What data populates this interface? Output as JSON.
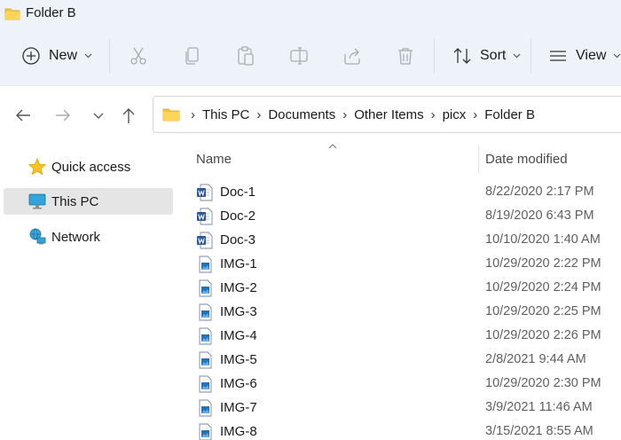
{
  "window": {
    "title": "Folder B"
  },
  "toolbar": {
    "new_label": "New",
    "sort_label": "Sort",
    "view_label": "View"
  },
  "breadcrumb": {
    "items": [
      "This PC",
      "Documents",
      "Other Items",
      "picx",
      "Folder B"
    ]
  },
  "sidebar": {
    "items": [
      {
        "label": "Quick access",
        "icon": "star-icon"
      },
      {
        "label": "This PC",
        "icon": "monitor-icon",
        "selected": true
      },
      {
        "label": "Network",
        "icon": "network-icon"
      }
    ]
  },
  "file_list": {
    "columns": {
      "name": "Name",
      "date": "Date modified"
    },
    "rows": [
      {
        "name": "Doc-1",
        "date": "8/22/2020 2:17 PM",
        "type": "word"
      },
      {
        "name": "Doc-2",
        "date": "8/19/2020 6:43 PM",
        "type": "word"
      },
      {
        "name": "Doc-3",
        "date": "10/10/2020 1:40 AM",
        "type": "word"
      },
      {
        "name": "IMG-1",
        "date": "10/29/2020 2:22 PM",
        "type": "image"
      },
      {
        "name": "IMG-2",
        "date": "10/29/2020 2:24 PM",
        "type": "image"
      },
      {
        "name": "IMG-3",
        "date": "10/29/2020 2:25 PM",
        "type": "image"
      },
      {
        "name": "IMG-4",
        "date": "10/29/2020 2:26 PM",
        "type": "image"
      },
      {
        "name": "IMG-5",
        "date": "2/8/2021 9:44 AM",
        "type": "image"
      },
      {
        "name": "IMG-6",
        "date": "10/29/2020 2:30 PM",
        "type": "image"
      },
      {
        "name": "IMG-7",
        "date": "3/9/2021 11:46 AM",
        "type": "image"
      },
      {
        "name": "IMG-8",
        "date": "3/15/2021 8:55 AM",
        "type": "image"
      }
    ]
  },
  "colors": {
    "chrome_bg": "#eef2f9",
    "selected_bg": "#e5e5e5",
    "folder": "#f5c342",
    "word_blue": "#2b579a"
  }
}
